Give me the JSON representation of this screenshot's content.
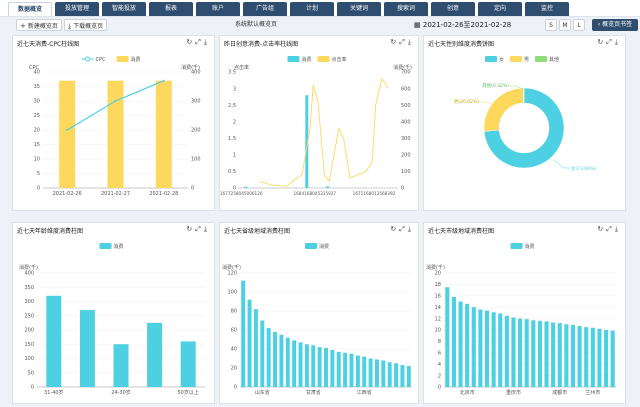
{
  "nav": {
    "tabs": [
      {
        "label": "数据概览",
        "active": true
      },
      {
        "label": "投放管理"
      },
      {
        "label": "智能投放"
      },
      {
        "label": "报表"
      },
      {
        "label": "账户"
      },
      {
        "label": "广告组"
      },
      {
        "label": "计划"
      },
      {
        "label": "关键词"
      },
      {
        "label": "搜索词"
      },
      {
        "label": "创意"
      },
      {
        "label": "定向"
      },
      {
        "label": "监控"
      }
    ]
  },
  "toolbar": {
    "new_view": "新建概览页",
    "download_view": "下载概览页",
    "default_view": "系统默认概览页",
    "date_range": "2021-02-26至2021-02-28",
    "sizes": [
      "S",
      "M",
      "L"
    ],
    "active_size": "S",
    "view_book": "概览页书签"
  },
  "colors": {
    "accent": "#4dd0e1",
    "yellow": "#fdd85d",
    "green": "#8fdc7a",
    "nav": "#2f4d6e"
  },
  "panels": {
    "p1": {
      "title": "近七天消费-CPC柱线图"
    },
    "p2": {
      "title": "昨日创意消费-点击率柱线图"
    },
    "p3": {
      "title": "近七天性别维度消费饼图"
    },
    "p4": {
      "title": "近七天年龄维度消费柱图"
    },
    "p5": {
      "title": "近七天省级地域消费柱图"
    },
    "p6": {
      "title": "近七天市级地域消费柱图"
    }
  },
  "chart_data": [
    {
      "type": "bar",
      "id": "p1",
      "categories": [
        "2021-02-26",
        "2021-02-27",
        "2021-02-28"
      ],
      "series": [
        {
          "name": "CPC",
          "type": "line",
          "axis": "left",
          "values": [
            20,
            30,
            37
          ]
        },
        {
          "name": "消费",
          "type": "bar",
          "axis": "right",
          "values": [
            370,
            370,
            370
          ]
        }
      ],
      "ylabel_left": "CPC",
      "ylabel_right": "消费(千)",
      "ylim_left": [
        0,
        40
      ],
      "yticks_left": [
        0,
        5,
        10,
        15,
        20,
        25,
        30,
        35,
        40
      ],
      "ylim_right": [
        0,
        400
      ],
      "yticks_right": [
        0,
        100,
        200,
        300,
        400
      ],
      "legend": "top"
    },
    {
      "type": "bar",
      "id": "p2",
      "categories": [
        "1677258045006120",
        "1684168045315927",
        "1671168013568392"
      ],
      "series": [
        {
          "name": "消费",
          "type": "bar",
          "axis": "right",
          "bars": [
            [
              0.05,
              8
            ],
            [
              0.43,
              560
            ],
            [
              0.56,
              10
            ]
          ]
        },
        {
          "name": "点击率",
          "type": "line",
          "axis": "left",
          "points": [
            [
              0.14,
              0.2
            ],
            [
              0.2,
              0.1
            ],
            [
              0.3,
              0.05
            ],
            [
              0.4,
              0.4
            ],
            [
              0.45,
              1.8
            ],
            [
              0.47,
              3.1
            ],
            [
              0.5,
              2.6
            ],
            [
              0.54,
              0.4
            ],
            [
              0.57,
              0.2
            ],
            [
              0.6,
              1.0
            ],
            [
              0.63,
              1.8
            ],
            [
              0.66,
              1.5
            ],
            [
              0.7,
              0.3
            ],
            [
              0.8,
              0.5
            ],
            [
              0.84,
              0.8
            ],
            [
              0.86,
              2.5
            ],
            [
              0.9,
              3.3
            ],
            [
              0.94,
              3.0
            ]
          ]
        }
      ],
      "ylabel_left": "点击率",
      "ylabel_right": "消费(千)",
      "ylim_left": [
        0,
        3.5
      ],
      "yticks_left": [
        0,
        0.5,
        1,
        1.5,
        2,
        2.5,
        3,
        3.5
      ],
      "ylim_right": [
        0,
        700
      ],
      "yticks_right": [
        0,
        100,
        200,
        300,
        400,
        500,
        600,
        700
      ],
      "legend": "top"
    },
    {
      "type": "pie",
      "id": "p3",
      "labels": [
        "女",
        "男",
        "其他"
      ],
      "values": [
        73.66,
        26.02,
        0.32
      ],
      "value_labels": [
        "女(73.66%)",
        "男(26.02%)",
        "其他(0.32%)"
      ],
      "legend": "top"
    },
    {
      "type": "bar",
      "id": "p4",
      "categories": [
        "31-40岁",
        "",
        "24-30岁",
        "",
        "50岁以上"
      ],
      "values": [
        320,
        270,
        150,
        225,
        160
      ],
      "series_name": "消费",
      "ylabel": "消费(千)",
      "ylim": [
        0,
        400
      ],
      "yticks": [
        0,
        50,
        100,
        150,
        200,
        250,
        300,
        350,
        400
      ],
      "legend": "top"
    },
    {
      "type": "bar",
      "id": "p5",
      "category_labels": [
        "山东省",
        "甘肃省",
        "江西省"
      ],
      "label_positions": [
        3,
        11,
        19
      ],
      "values": [
        112,
        92,
        82,
        70,
        62,
        58,
        55,
        52,
        49,
        47,
        45,
        44,
        42,
        41,
        39,
        37,
        36,
        35,
        33,
        32,
        30,
        29,
        28,
        26,
        25,
        23,
        22
      ],
      "series_name": "消费",
      "ylabel": "消费(千)",
      "ylim": [
        0,
        120
      ],
      "yticks": [
        0,
        20,
        40,
        60,
        80,
        100,
        120
      ],
      "legend": "top"
    },
    {
      "type": "bar",
      "id": "p6",
      "category_labels": [
        "北京市",
        "重庆市",
        "成都市",
        "兰州市"
      ],
      "label_positions": [
        3,
        10,
        17,
        22
      ],
      "values": [
        17.5,
        15.8,
        15.0,
        14.6,
        14.0,
        13.6,
        13.4,
        13.1,
        12.9,
        12.5,
        12.2,
        12.0,
        11.9,
        11.7,
        11.6,
        11.5,
        11.3,
        11.2,
        11.0,
        10.9,
        10.7,
        10.5,
        10.4,
        10.2,
        10.0,
        9.9
      ],
      "series_name": "消费",
      "ylabel": "消费(千)",
      "ylim": [
        0,
        20
      ],
      "yticks": [
        0,
        2,
        4,
        6,
        8,
        10,
        12,
        14,
        16,
        18,
        20
      ],
      "legend": "top"
    }
  ]
}
